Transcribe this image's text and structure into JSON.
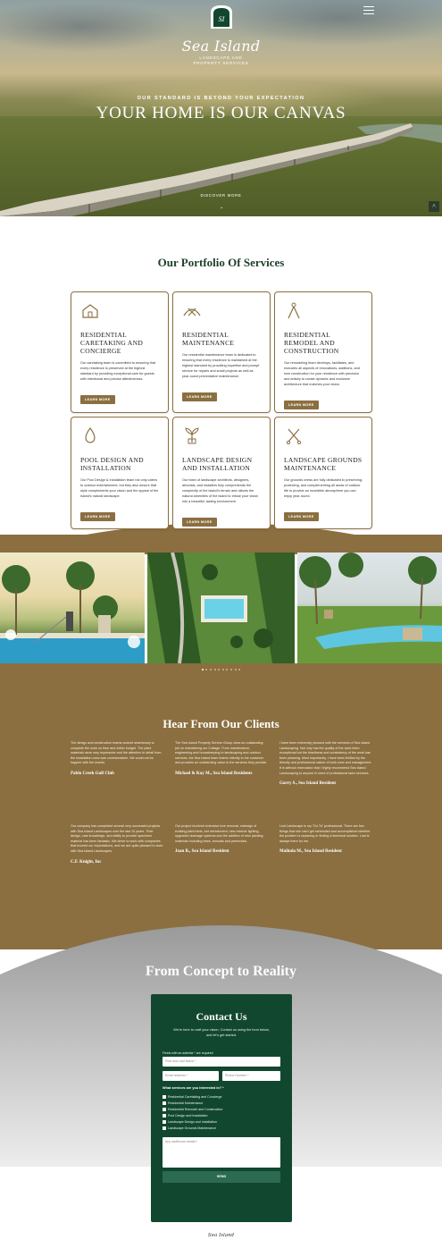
{
  "hero": {
    "brand": "Sea Island",
    "brand_sub_line1": "LANDSCAPE AND",
    "brand_sub_line2": "PROPERTY SERVICES",
    "kicker": "OUR STANDARD IS BEYOND YOUR EXPECTATION",
    "title": "YOUR HOME IS OUR CANVAS",
    "discover": "DISCOVER MORE",
    "down_arrow": "⌄",
    "scroll_top": "^"
  },
  "services": {
    "title": "Our Portfolio Of Services",
    "button_label": "LEARN MORE",
    "cards": [
      {
        "title": "RESIDENTIAL CARETAKING AND CONCIERGE",
        "icon": "house-icon",
        "text": "Our caretaking team is committed to ensuring that every residence is preserved at the highest standard by providing exceptional care for guests with intentional and precise attentiveness."
      },
      {
        "title": "RESIDENTIAL MAINTENANCE",
        "icon": "tools-icon",
        "text": "Our residential maintenance team is dedicated to ensuring that every residence is maintained at the highest standard by providing expertise and prompt service for repairs and small projects as well as year-round preventative maintenance."
      },
      {
        "title": "RESIDENTIAL REMODEL AND CONSTRUCTION",
        "icon": "compass-icon",
        "text": "Our remodeling team develops, facilitates, and executes all aspects of renovations, additions, and new construction for your residence with precision and artistry to create dynamic and exclusive architecture that matches your vision."
      },
      {
        "title": "POOL DESIGN AND INSTALLATION",
        "icon": "water-drop-icon",
        "text": "Our Pool Design & Installation team not only caters to outdoor entertainment, but they also ensure that style complements your vision and the appeal of the island's natural landscape."
      },
      {
        "title": "LANDSCAPE DESIGN AND INSTALLATION",
        "icon": "plant-icon",
        "text": "Our team of landscape architects, designers, arborists, and installers fully comprehends the complexity of the island's terrain and utilizes the natural amenities of the island to infuse your vision into a beautiful, lasting environment."
      },
      {
        "title": "LANDSCAPE GROUNDS MAINTENANCE",
        "icon": "shears-icon",
        "text": "Our grounds crews are fully dedicated to preserving, protecting, and complementing all areas of outdoor life to provide an incredible atmosphere you can enjoy year-round."
      }
    ]
  },
  "gallery": {
    "images": [
      "pool-cleaning-photo",
      "aerial-pool-photo",
      "poolside-lawn-photo"
    ],
    "dot_count": 10,
    "active_dot": 0
  },
  "testimonials": {
    "title": "Hear From Our Clients",
    "items": [
      {
        "text": "The design and construction teams worked seamlessly to complete the work on time and within budget. The plant materials were very impressive and the attention to detail from the installation crew was commendable. We could not be happier with the results.",
        "author": "Pablo Creek Golf Club"
      },
      {
        "text": "The Sea Island Property Service Group does an outstanding job on maintaining our Cottage. From maintenance, engineering and housekeeping to landscaping and outdoor services, the Sea Island team listens intently to the customer and provides an outstanding value to the services they provide.",
        "author": "Michael & Kay M., Sea Island Residents"
      },
      {
        "text": "I have been extremely pleased with the services of Sea Island Landscaping. Not only has the quality of the work been exceptional but the timeliness and consistency of the work has been pleasing. Most importantly, I have been thrilled by the friendly and professional nature of both crew and management. It is without reservation that I highly recommend Sea Island Landscaping to anyone in need of professional lawn services.",
        "author": "Garry S., Sea Island Resident"
      },
      {
        "text": "Our company has completed several very successful projects with Sea Island Landscapes over the last 10 years. Their design, vast knowledge, and ability to provide specimen material has been fantastic. We strive to work with companies that exceed our expectations, and we are quite pleased to work with Sea Island Landscapes.",
        "author": "C.F. Knight, Inc"
      },
      {
        "text": "Our project involved extensive tree removal, redesign of existing plant beds, turf refreshment, new exterior lighting, upgraded drainage systems and the addition of new planting materials including trees, annuals and perennials.",
        "author": "Joan B., Sea Island Resident"
      },
      {
        "text": "Lost Landscape is my \"Go To\" professional. There are few things that she can't get scheduled and accomplished whether the problem is replacing or finding a technical solution. Lost is always there for me.",
        "author": "Malinda M., Sea Island Resident"
      }
    ]
  },
  "contact": {
    "section_title": "From Concept to Reality",
    "title": "Contact Us",
    "intro": "We're here to craft your vision. Contact us using the form below, and let's get started.",
    "required_note": "Fields with an asterisk * are required",
    "name_placeholder": "First and Last Name *",
    "email_placeholder": "Email Address *",
    "phone_placeholder": "Phone Number *",
    "services_question": "What services are you interested in? *",
    "options": [
      "Residential Caretaking and Concierge",
      "Residential Maintenance",
      "Residential Remodel and Construction",
      "Pool Design and Installation",
      "Landscape Design and Installation",
      "Landscape Grounds Maintenance"
    ],
    "details_placeholder": "Any additional details?",
    "send_label": "SEND"
  },
  "footer": {
    "brand": "Sea Island"
  },
  "colors": {
    "brown": "#8b6f40",
    "green": "#12472f",
    "title_green": "#1f3f2c"
  }
}
